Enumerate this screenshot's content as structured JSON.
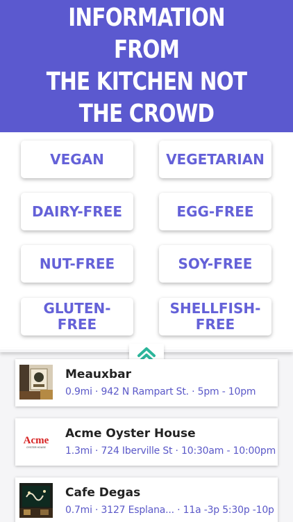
{
  "hero": {
    "title": "INFORMATION FROM\nTHE KITCHEN NOT\nTHE CROWD",
    "background_color": "#5b59cf"
  },
  "filters": [
    {
      "label": "VEGAN"
    },
    {
      "label": "VEGETARIAN"
    },
    {
      "label": "DAIRY-FREE"
    },
    {
      "label": "EGG-FREE"
    },
    {
      "label": "NUT-FREE"
    },
    {
      "label": "SOY-FREE"
    },
    {
      "label_line1": "GLUTEN-",
      "label_line2": "FREE"
    },
    {
      "label_line1": "SHELLFISH-",
      "label_line2": "FREE"
    }
  ],
  "collapse_toggle": {
    "icon": "double-chevron-up-icon",
    "color": "#2bb59a"
  },
  "restaurants": [
    {
      "name": "Meauxbar",
      "meta": "0.9mi · 942 N Rampart St. · 5pm - 10pm",
      "thumb_icon": "restaurant-photo"
    },
    {
      "name": "Acme Oyster House",
      "meta": "1.3mi · 724 Iberville St · 10:30am - 10:00pm",
      "logo_text": "Acme",
      "logo_subtext": "OYSTER HOUSE"
    },
    {
      "name": "Cafe Degas",
      "meta": "0.7mi · 3127 Esplana... · 11a -3p 5:30p -10p",
      "thumb_icon": "restaurant-photo"
    }
  ],
  "colors": {
    "accent": "#6461d8",
    "meta_text": "#5a58c8",
    "chevron": "#2bb59a"
  }
}
